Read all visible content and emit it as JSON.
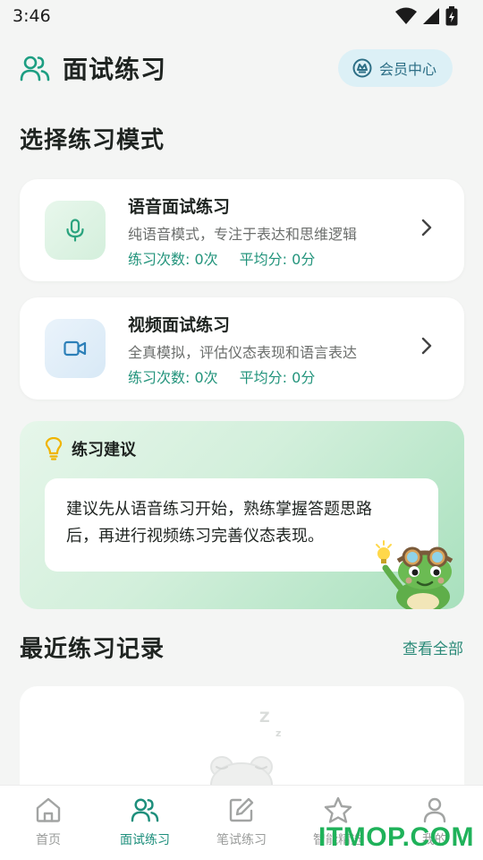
{
  "status_bar": {
    "time": "3:46"
  },
  "header": {
    "title": "面试练习",
    "member_label": "会员中心"
  },
  "mode_section": {
    "title": "选择练习模式",
    "cards": [
      {
        "title": "语音面试练习",
        "desc": "纯语音模式，专注于表达和思维逻辑",
        "count": "练习次数: 0次",
        "score": "平均分: 0分"
      },
      {
        "title": "视频面试练习",
        "desc": "全真模拟，评估仪态表现和语言表达",
        "count": "练习次数: 0次",
        "score": "平均分: 0分"
      }
    ]
  },
  "tip": {
    "title": "练习建议",
    "line1": "建议先从语音练习开始，熟练掌握答题思路",
    "line2": "后，再进行视频练习完善仪态表现。"
  },
  "recent": {
    "title": "最近练习记录",
    "view_all": "查看全部"
  },
  "nav": [
    {
      "label": "首页",
      "icon": "home-icon",
      "active": false
    },
    {
      "label": "面试练习",
      "icon": "users-icon",
      "active": true
    },
    {
      "label": "笔试练习",
      "icon": "edit-icon",
      "active": false
    },
    {
      "label": "智能精选",
      "icon": "star-icon",
      "active": false
    },
    {
      "label": "我的",
      "icon": "user-icon",
      "active": false
    }
  ],
  "watermark": "ITMOP.COM",
  "colors": {
    "accent": "#1d8f7c",
    "stat_green": "#23947c",
    "member_bg": "#dcf0f6",
    "watermark": "#1fb25a"
  }
}
